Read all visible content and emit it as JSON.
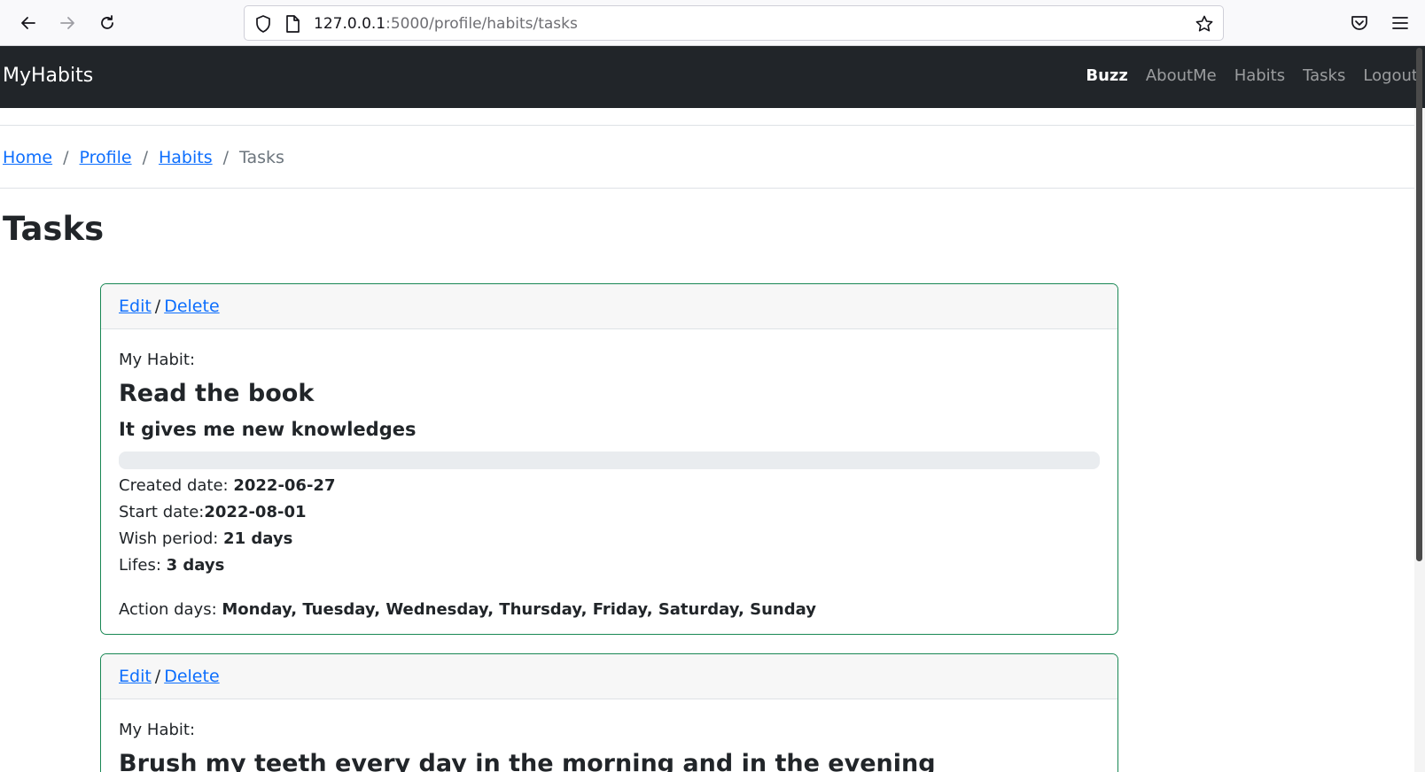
{
  "browser": {
    "url_host": "127.0.0.1",
    "url_path": ":5000/profile/habits/tasks",
    "icons": [
      "back-icon",
      "forward-icon",
      "reload-icon",
      "shield-icon",
      "page-icon",
      "star-icon",
      "pocket-icon",
      "menu-icon"
    ]
  },
  "navbar": {
    "brand": "MyHabits",
    "links": [
      {
        "label": "Buzz",
        "active": true
      },
      {
        "label": "AboutMe",
        "active": false
      },
      {
        "label": "Habits",
        "active": false
      },
      {
        "label": "Tasks",
        "active": false
      },
      {
        "label": "Logout",
        "active": false
      }
    ]
  },
  "breadcrumb": {
    "items": [
      "Home",
      "Profile",
      "Habits"
    ],
    "separator": "/",
    "current": "Tasks"
  },
  "page": {
    "title": "Tasks"
  },
  "cards": [
    {
      "edit_label": "Edit",
      "slash": "/",
      "delete_label": "Delete",
      "habit_label": "My Habit:",
      "habit_name": "Read the book",
      "habit_desc": "It gives me new knowledges",
      "progress": 0,
      "created_label": "Created date: ",
      "created_value": "2022-06-27",
      "start_label": "Start date:",
      "start_value": "2022-08-01",
      "wish_label": "Wish period: ",
      "wish_value": "21 days",
      "lifes_label": "Lifes: ",
      "lifes_value": "3 days",
      "action_label": "Action days: ",
      "action_value": "Monday, Tuesday, Wednesday, Thursday, Friday, Saturday, Sunday"
    },
    {
      "edit_label": "Edit",
      "slash": "/",
      "delete_label": "Delete",
      "habit_label": "My Habit:",
      "habit_name": "Brush my teeth every day in the morning and in the evening"
    }
  ],
  "colors": {
    "navbar_bg": "#212529",
    "link": "#0d6efd",
    "card_border": "#198754",
    "progress_track": "#e9ecef"
  }
}
